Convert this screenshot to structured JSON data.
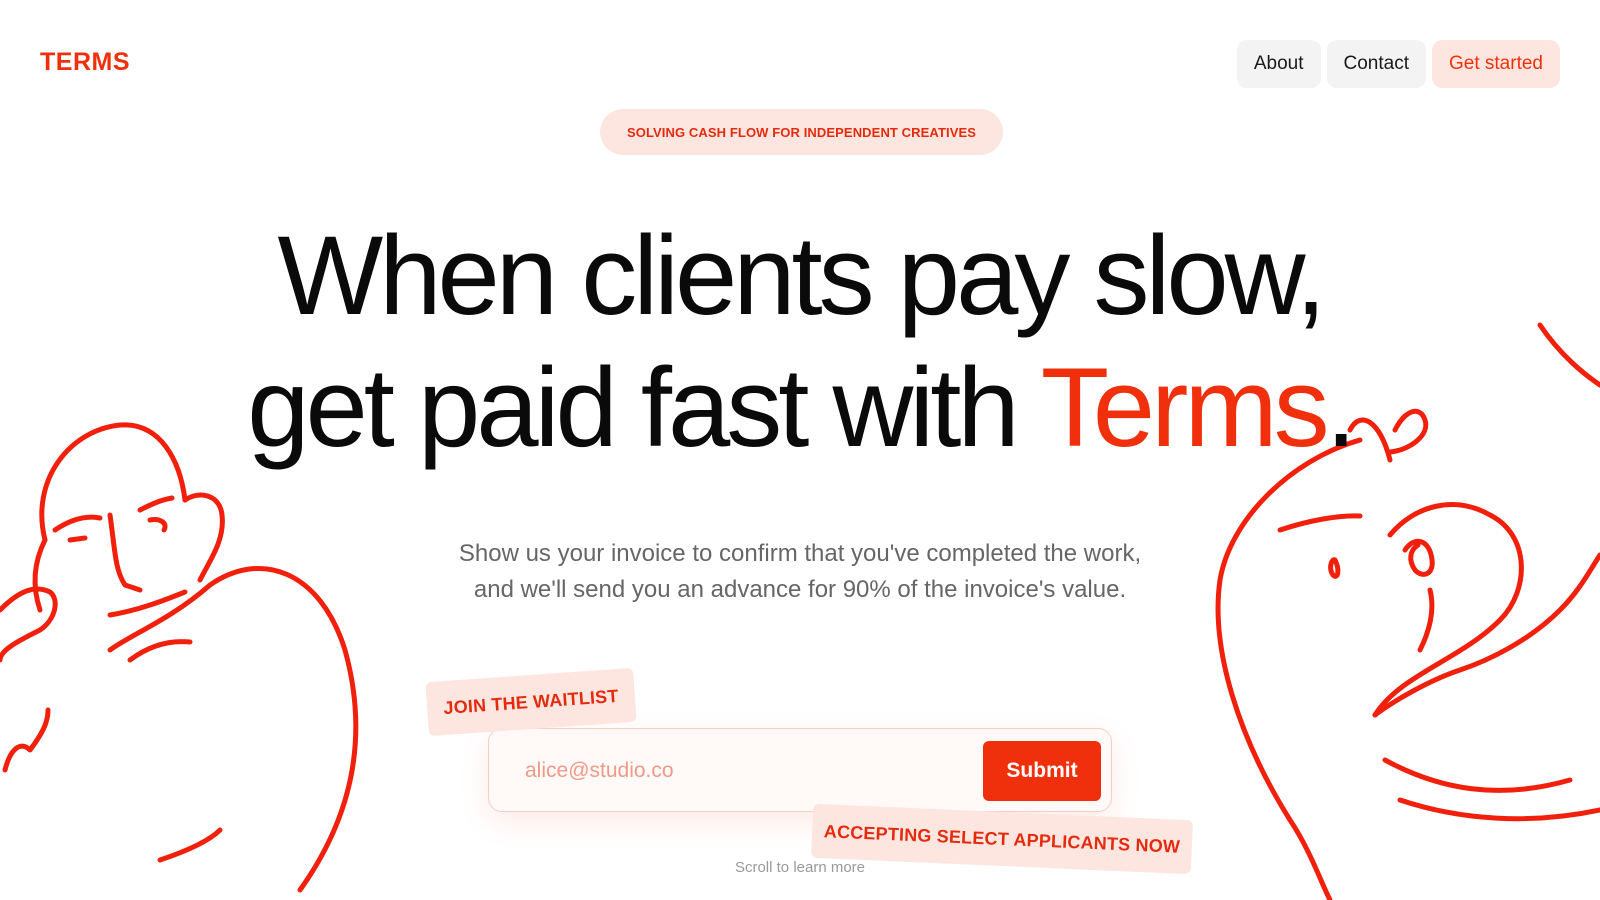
{
  "brand": {
    "logo": "TERMS",
    "accent_color": "#f0300c",
    "tint_color": "#fde6e0"
  },
  "nav": {
    "about": "About",
    "contact": "Contact",
    "get_started": "Get started"
  },
  "hero": {
    "pill": "SOLVING CASH FLOW FOR INDEPENDENT CREATIVES",
    "headline_line1": "When clients pay slow,",
    "headline_line2_prefix": "get paid fast with ",
    "headline_accent": "Terms",
    "headline_period": ".",
    "subtitle_line1": "Show us your invoice to confirm that you've completed the work,",
    "subtitle_line2": "and we'll send you an advance for 90% of the invoice's value."
  },
  "waitlist": {
    "tag": "JOIN THE WAITLIST",
    "email_placeholder": "alice@studio.co",
    "submit": "Submit",
    "accepting": "ACCEPTING SELECT APPLICANTS NOW"
  },
  "footer": {
    "scroll_hint": "Scroll to learn more"
  },
  "illustrations": {
    "left": "face-doodle-left",
    "right": "face-doodle-right"
  }
}
